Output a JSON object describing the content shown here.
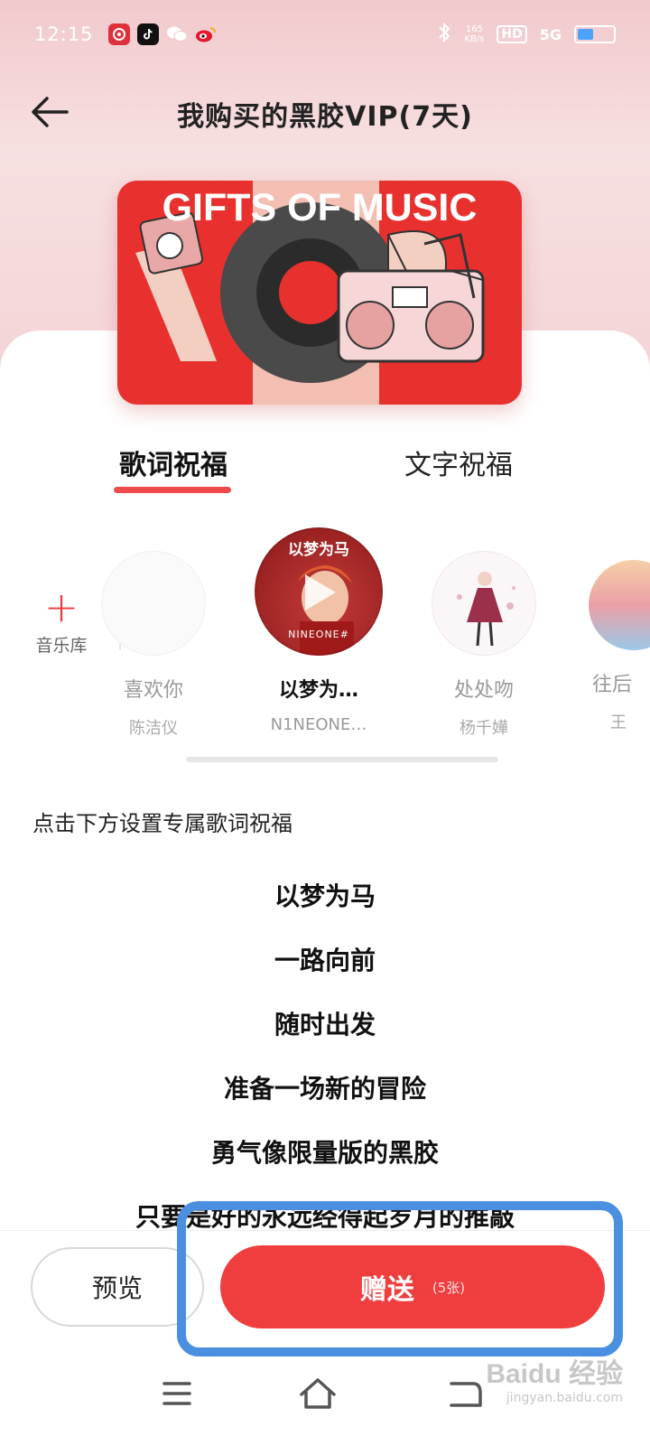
{
  "status_bar": {
    "time": "12:15",
    "network_speed": "165",
    "network_speed_unit": "KB/s",
    "hd_label": "HD",
    "signal_label": "5G"
  },
  "header": {
    "title": "我购买的黑胶VIP(7天)"
  },
  "banner": {
    "title": "GIFTS OF MUSIC"
  },
  "tabs": [
    {
      "label": "歌词祝福",
      "active": true
    },
    {
      "label": "文字祝福",
      "active": false
    }
  ],
  "library": {
    "label": "音乐库"
  },
  "songs": [
    {
      "title": "喜欢你",
      "artist": "陈洁仪",
      "selected": false
    },
    {
      "title": "以梦为…",
      "artist": "N1NEONE…",
      "selected": true,
      "cover_text": "以梦为马",
      "cover_artist": "NINEONE#"
    },
    {
      "title": "处处吻",
      "artist": "杨千嬅",
      "selected": false
    },
    {
      "title": "往后",
      "artist": "王",
      "selected": false
    }
  ],
  "hint": "点击下方设置专属歌词祝福",
  "lyrics": [
    "以梦为马",
    "一路向前",
    "随时出发",
    "准备一场新的冒险",
    "勇气像限量版的黑胶",
    "只要是好的永远经得起岁月的推敲"
  ],
  "actions": {
    "preview_label": "预览",
    "gift_label": "赠送",
    "gift_count": "(5张)"
  },
  "watermark": {
    "main": "Baidu 经验",
    "sub": "jingyan.baidu.com"
  },
  "colors": {
    "accent": "#f03d3d",
    "highlight": "#4a8fe0",
    "banner": "#e8312e"
  }
}
